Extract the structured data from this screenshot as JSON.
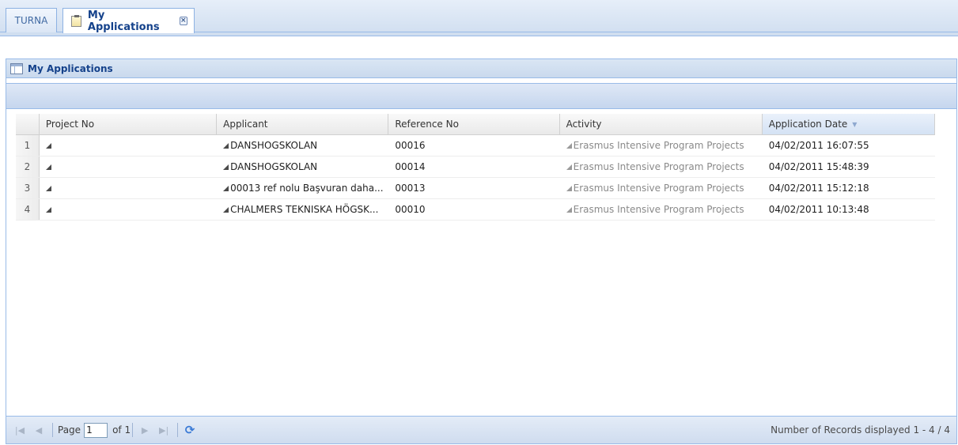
{
  "tabs": {
    "home_label": "TURNA",
    "active_label": "My Applications"
  },
  "panel": {
    "title": "My Applications"
  },
  "grid": {
    "columns": {
      "project_no": "Project No",
      "applicant": "Applicant",
      "reference_no": "Reference No",
      "activity": "Activity",
      "application_date": "Application Date"
    },
    "sort": {
      "column": "application_date",
      "direction": "descending"
    },
    "rows": [
      {
        "num": "1",
        "project_no": "",
        "applicant": "DANSHOGSKOLAN",
        "reference_no": "00016",
        "activity": "Erasmus Intensive Program Projects",
        "application_date": "04/02/2011 16:07:55"
      },
      {
        "num": "2",
        "project_no": "",
        "applicant": "DANSHOGSKOLAN",
        "reference_no": "00014",
        "activity": "Erasmus Intensive Program Projects",
        "application_date": "04/02/2011 15:48:39"
      },
      {
        "num": "3",
        "project_no": "",
        "applicant": "00013 ref nolu Başvuran daha...",
        "reference_no": "00013",
        "activity": "Erasmus Intensive Program Projects",
        "application_date": "04/02/2011 15:12:18"
      },
      {
        "num": "4",
        "project_no": "",
        "applicant": "CHALMERS TEKNISKA HÖGSK...",
        "reference_no": "00010",
        "activity": "Erasmus Intensive Program Projects",
        "application_date": "04/02/2011 10:13:48"
      }
    ]
  },
  "paging": {
    "page_label": "Page",
    "page_value": "1",
    "of_label": "of 1",
    "records_info": "Number of Records displayed 1 - 4 / 4"
  },
  "icons": {
    "tab_icon": "notepad-icon",
    "tab_close": "close-icon",
    "panel_icon": "grid-icon",
    "first": "first-page-icon",
    "prev": "prev-page-icon",
    "next": "next-page-icon",
    "last": "last-page-icon",
    "refresh": "refresh-icon"
  },
  "colors": {
    "header_blue": "#15428b",
    "border_blue": "#99bbe8"
  }
}
